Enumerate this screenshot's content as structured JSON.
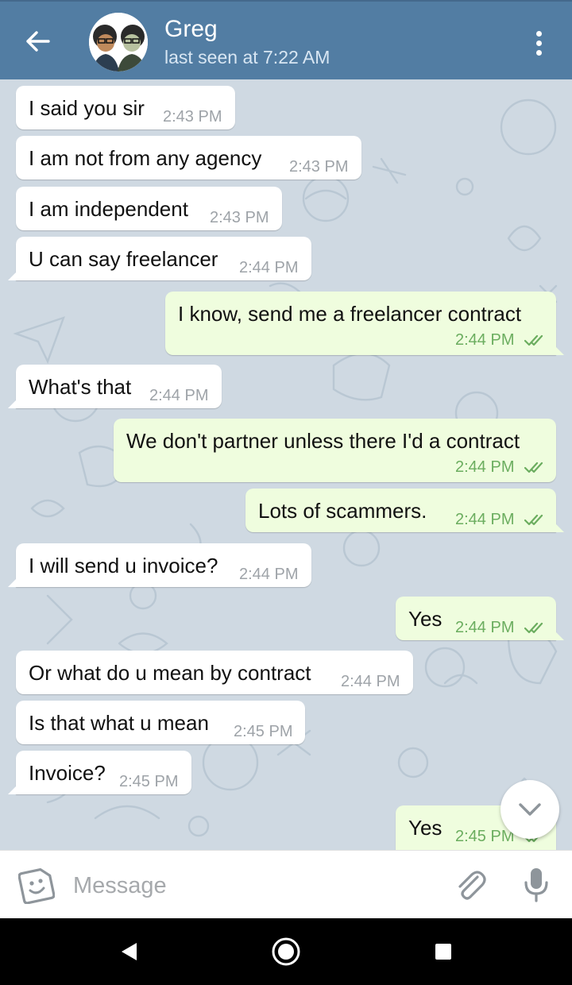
{
  "header": {
    "name": "Greg",
    "status": "last seen at 7:22 AM"
  },
  "messages": [
    {
      "dir": "in",
      "text": "I said you sir",
      "time": "2:43 PM"
    },
    {
      "dir": "in",
      "text": "I am not from any agency",
      "time": "2:43 PM"
    },
    {
      "dir": "in",
      "text": "I am independent",
      "time": "2:43 PM"
    },
    {
      "dir": "in",
      "text": "U can say freelancer",
      "time": "2:44 PM"
    },
    {
      "dir": "out",
      "text": "I know, send me a freelancer contract",
      "time": "2:44 PM",
      "read": true
    },
    {
      "dir": "in",
      "text": "What's that",
      "time": "2:44 PM"
    },
    {
      "dir": "out",
      "text": "We don't partner unless there I'd a contract",
      "time": "2:44 PM",
      "read": true
    },
    {
      "dir": "out",
      "text": "Lots of scammers.",
      "time": "2:44 PM",
      "read": true
    },
    {
      "dir": "in",
      "text": "I will send u invoice?",
      "time": "2:44 PM"
    },
    {
      "dir": "out",
      "text": "Yes",
      "time": "2:44 PM",
      "read": true
    },
    {
      "dir": "in",
      "text": "Or what do u mean by contract",
      "time": "2:44 PM"
    },
    {
      "dir": "in",
      "text": "Is that what u mean",
      "time": "2:45 PM"
    },
    {
      "dir": "in",
      "text": "Invoice?",
      "time": "2:45 PM"
    },
    {
      "dir": "out",
      "text": "Yes",
      "time": "2:45 PM",
      "read": true
    }
  ],
  "input": {
    "placeholder": "Message"
  },
  "colors": {
    "header": "#527da3",
    "chat_background": "#cfd9e2",
    "incoming_bubble": "#ffffff",
    "outgoing_bubble": "#effdde",
    "outgoing_time": "#6bad5f",
    "icon_gray": "#8e959b"
  },
  "icons": [
    "back-arrow-icon",
    "avatar",
    "more-vertical-icon",
    "double-check-icon",
    "chevron-down-icon",
    "sticker-icon",
    "paperclip-icon",
    "microphone-icon",
    "nav-back-icon",
    "nav-home-icon",
    "nav-recents-icon"
  ]
}
